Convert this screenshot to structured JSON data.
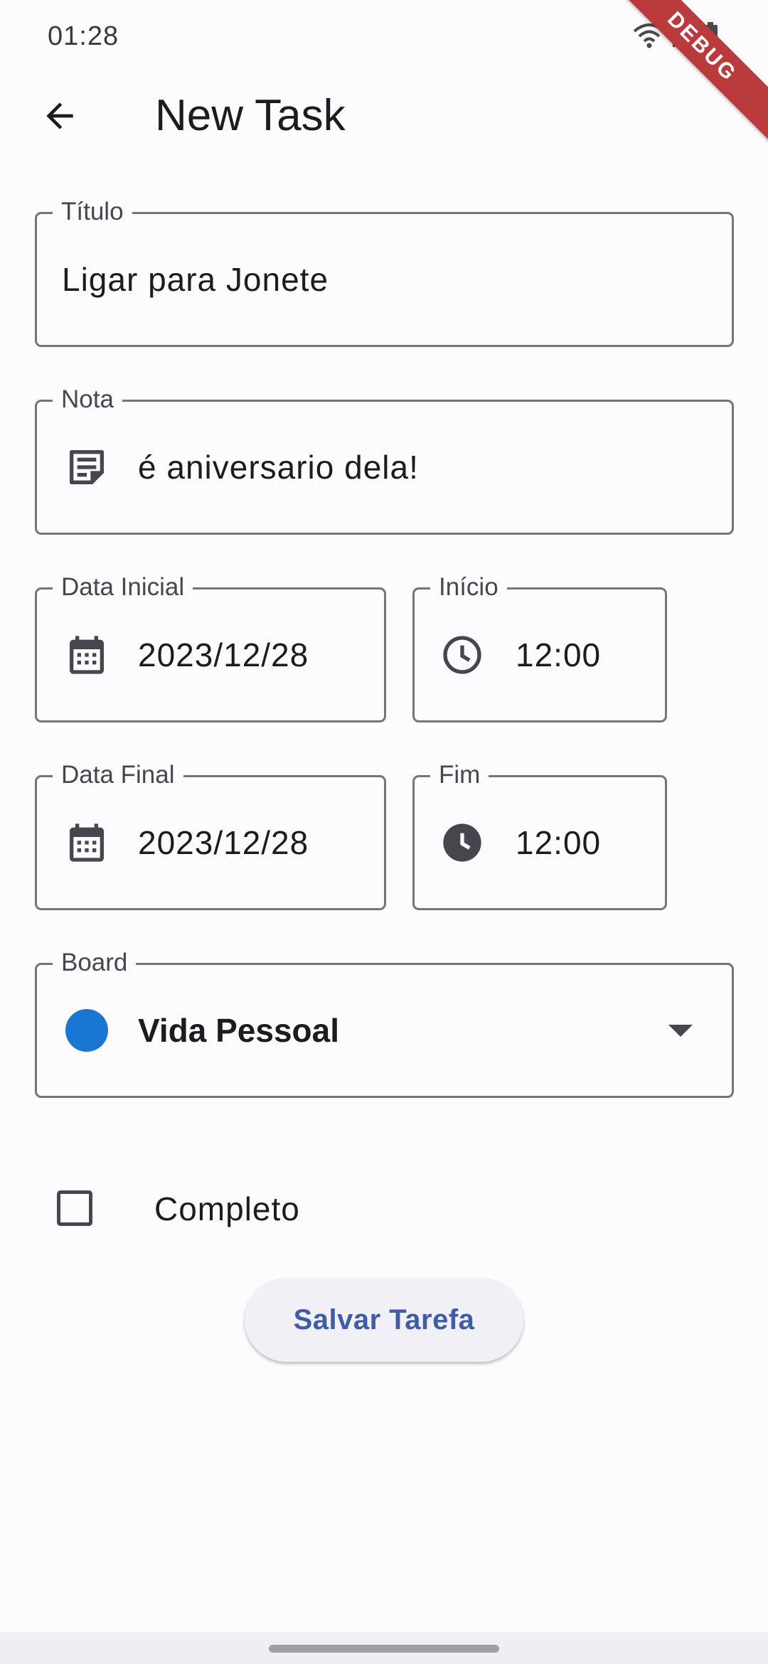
{
  "status_bar": {
    "time": "01:28",
    "icons": [
      "wifi-icon",
      "signal-icon",
      "battery-icon"
    ],
    "debug_label": "DEBUG"
  },
  "app_bar": {
    "title": "New Task",
    "back_icon": "arrow-back-icon"
  },
  "form": {
    "title": {
      "label": "Título",
      "value": "Ligar para Jonete"
    },
    "note": {
      "label": "Nota",
      "value": "é aniversario dela!",
      "icon": "note-icon"
    },
    "start_date": {
      "label": "Data Inicial",
      "value": "2023/12/28",
      "icon": "calendar-icon"
    },
    "start_time": {
      "label": "Início",
      "value": "12:00",
      "icon": "clock-outline-icon"
    },
    "end_date": {
      "label": "Data Final",
      "value": "2023/12/28",
      "icon": "calendar-icon"
    },
    "end_time": {
      "label": "Fim",
      "value": "12:00",
      "icon": "clock-filled-icon"
    },
    "board": {
      "label": "Board",
      "value": "Vida Pessoal",
      "color": "#1976d2"
    },
    "complete": {
      "label": "Completo",
      "checked": false
    },
    "save_label": "Salvar Tarefa"
  },
  "colors": {
    "background": "#fdfbfe",
    "border": "#74747a",
    "accent": "#3f5da3",
    "debug_banner": "#b93b3b"
  }
}
